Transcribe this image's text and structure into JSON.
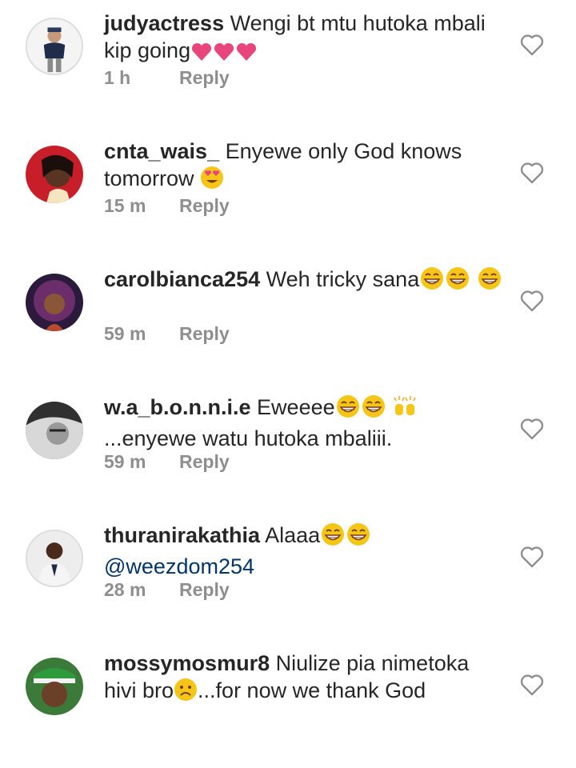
{
  "comments": [
    {
      "username": "judyactress",
      "text": "Wengi bt mtu hutoka mbali kip going",
      "emojis": [
        "pink-heart",
        "pink-heart",
        "pink-heart"
      ],
      "time": "1 h",
      "reply_label": "Reply"
    },
    {
      "username": "cnta_wais_",
      "text": "Enyewe only God knows tomorrow",
      "emojis": [
        "heart-eyes"
      ],
      "time": "15 m",
      "reply_label": "Reply"
    },
    {
      "username": "carolbianca254",
      "text": "Weh tricky sana",
      "emojis": [
        "grin",
        "grin",
        "grin"
      ],
      "time": "59 m",
      "reply_label": "Reply"
    },
    {
      "username": "w.a_b.o.n.n.i.e",
      "text_a": "Eweeee",
      "text_b": "...enyewe watu hutoka mbaliii.",
      "emojis": [
        "grin",
        "grin",
        "raised-hands"
      ],
      "time": "59 m",
      "reply_label": "Reply"
    },
    {
      "username": "thuranirakathia",
      "text": "Alaaa",
      "mention": "@weezdom254",
      "emojis": [
        "grin",
        "grin"
      ],
      "time": "28 m",
      "reply_label": "Reply"
    },
    {
      "username": "mossymosmur8",
      "text_a": "Niulize pia nimetoka hivi bro",
      "text_b": "...for now we thank God",
      "emojis": [
        "frown"
      ]
    }
  ],
  "icons": {
    "like": "heart-outline-icon"
  },
  "colors": {
    "meta": "#8e8e8e",
    "mention": "#003569",
    "heart_emoji": "#e8457d",
    "emoji_face": "#f5c518"
  }
}
